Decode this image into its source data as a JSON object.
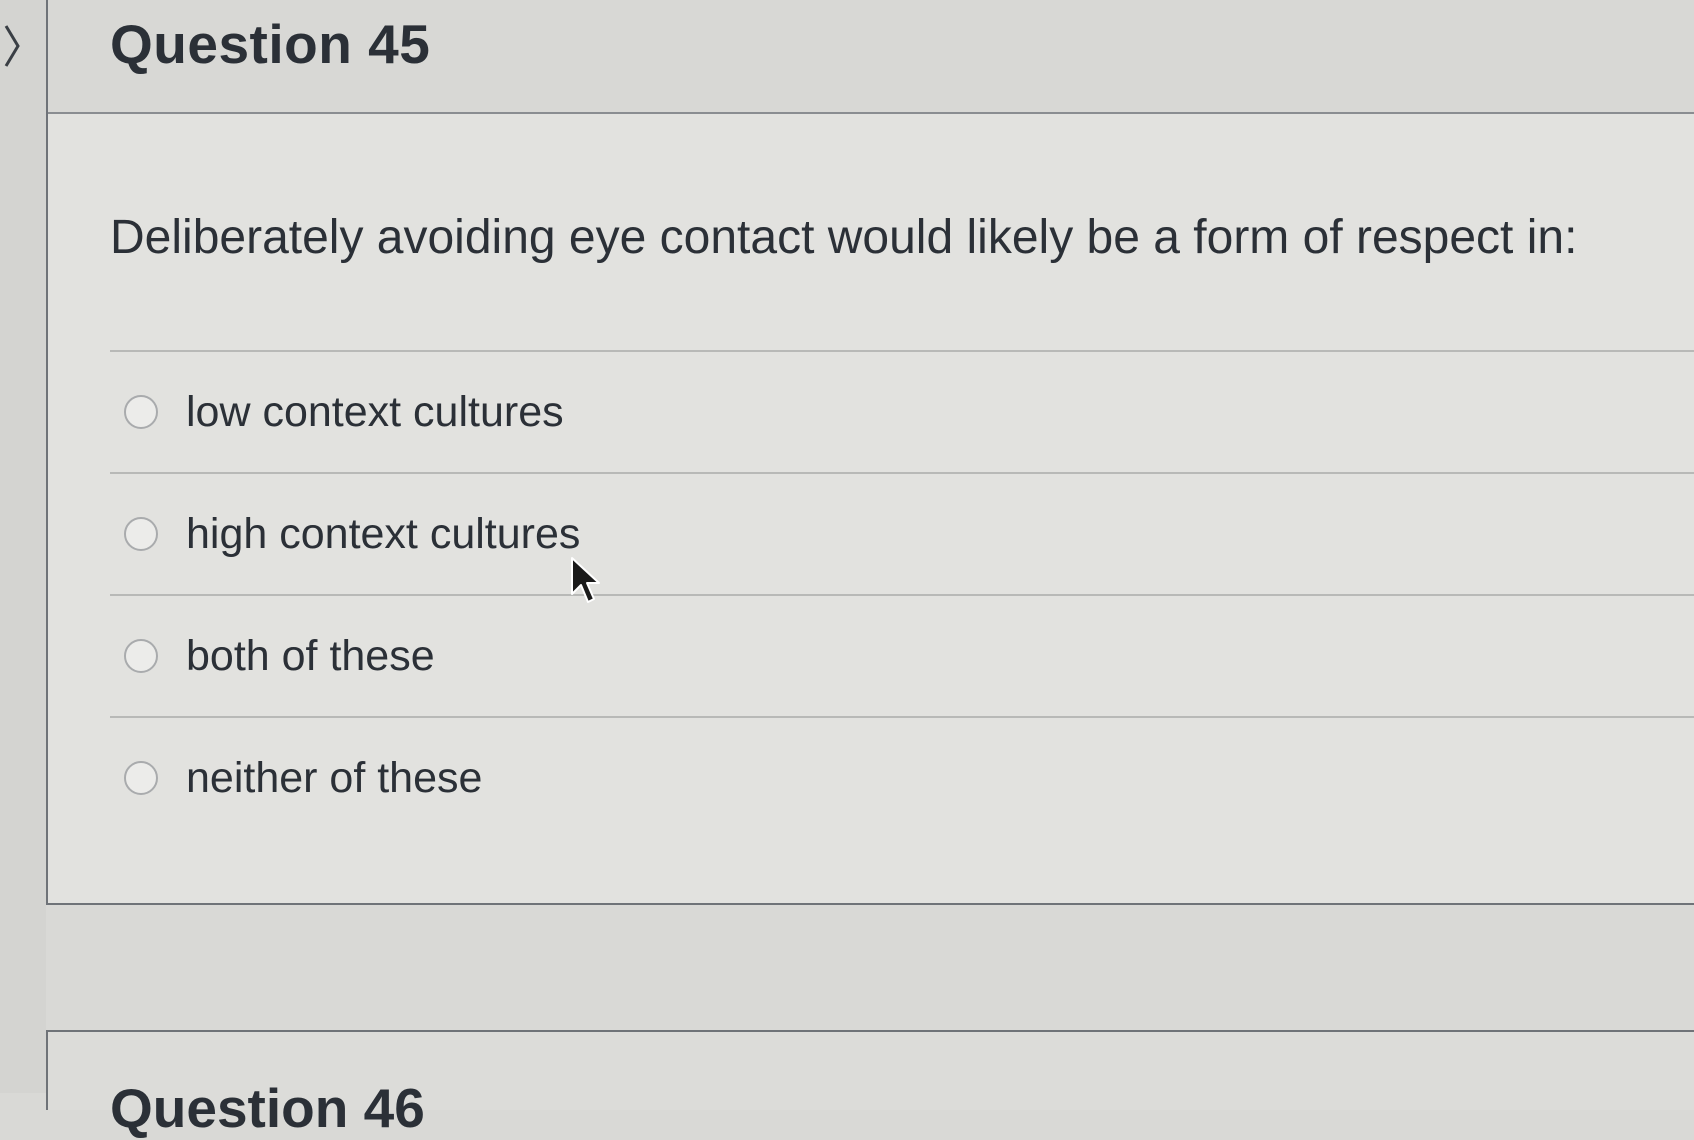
{
  "question": {
    "title": "Question 45",
    "text": "Deliberately avoiding eye contact would likely be a form of respect in:",
    "answers": [
      {
        "label": "low context cultures",
        "selected": false
      },
      {
        "label": "high context cultures",
        "selected": false
      },
      {
        "label": "both of these",
        "selected": false
      },
      {
        "label": "neither of these",
        "selected": false
      }
    ]
  },
  "next_question": {
    "title_fragment": "Question 46"
  },
  "icons": {
    "nav": "chevron-right-icon",
    "cursor": "mouse-pointer-icon"
  },
  "colors": {
    "text": "#2b3037",
    "card_background": "#e2e2df",
    "header_background": "#d8d8d5",
    "border": "#6f7378",
    "divider": "#b8b9b7"
  }
}
